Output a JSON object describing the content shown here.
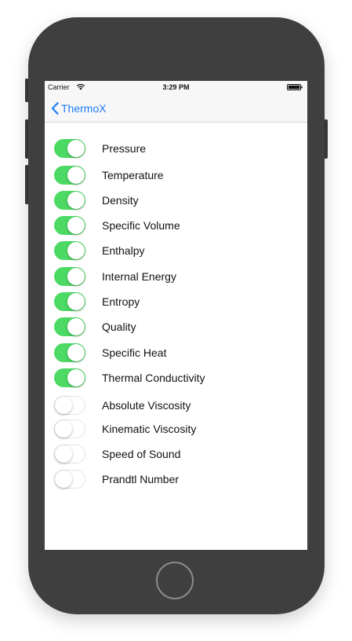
{
  "status_bar": {
    "carrier": "Carrier",
    "time": "3:29 PM",
    "wifi_icon": "wifi-icon",
    "battery_icon": "battery-icon"
  },
  "nav": {
    "back_label": "ThermoX",
    "back_icon": "chevron-left-icon",
    "accent_color": "#1e7cf5"
  },
  "switch_on_color": "#4cd964",
  "properties": [
    {
      "label": "Pressure",
      "on": true
    },
    {
      "label": "Temperature",
      "on": true
    },
    {
      "label": "Density",
      "on": true
    },
    {
      "label": "Specific Volume",
      "on": true
    },
    {
      "label": "Enthalpy",
      "on": true
    },
    {
      "label": "Internal Energy",
      "on": true
    },
    {
      "label": "Entropy",
      "on": true
    },
    {
      "label": "Quality",
      "on": true
    },
    {
      "label": "Specific Heat",
      "on": true
    },
    {
      "label": "Thermal Conductivity",
      "on": true
    },
    {
      "label": "Absolute Viscosity",
      "on": false
    },
    {
      "label": "Kinematic Viscosity",
      "on": false
    },
    {
      "label": "Speed of Sound",
      "on": false
    },
    {
      "label": "Prandtl Number",
      "on": false
    }
  ]
}
